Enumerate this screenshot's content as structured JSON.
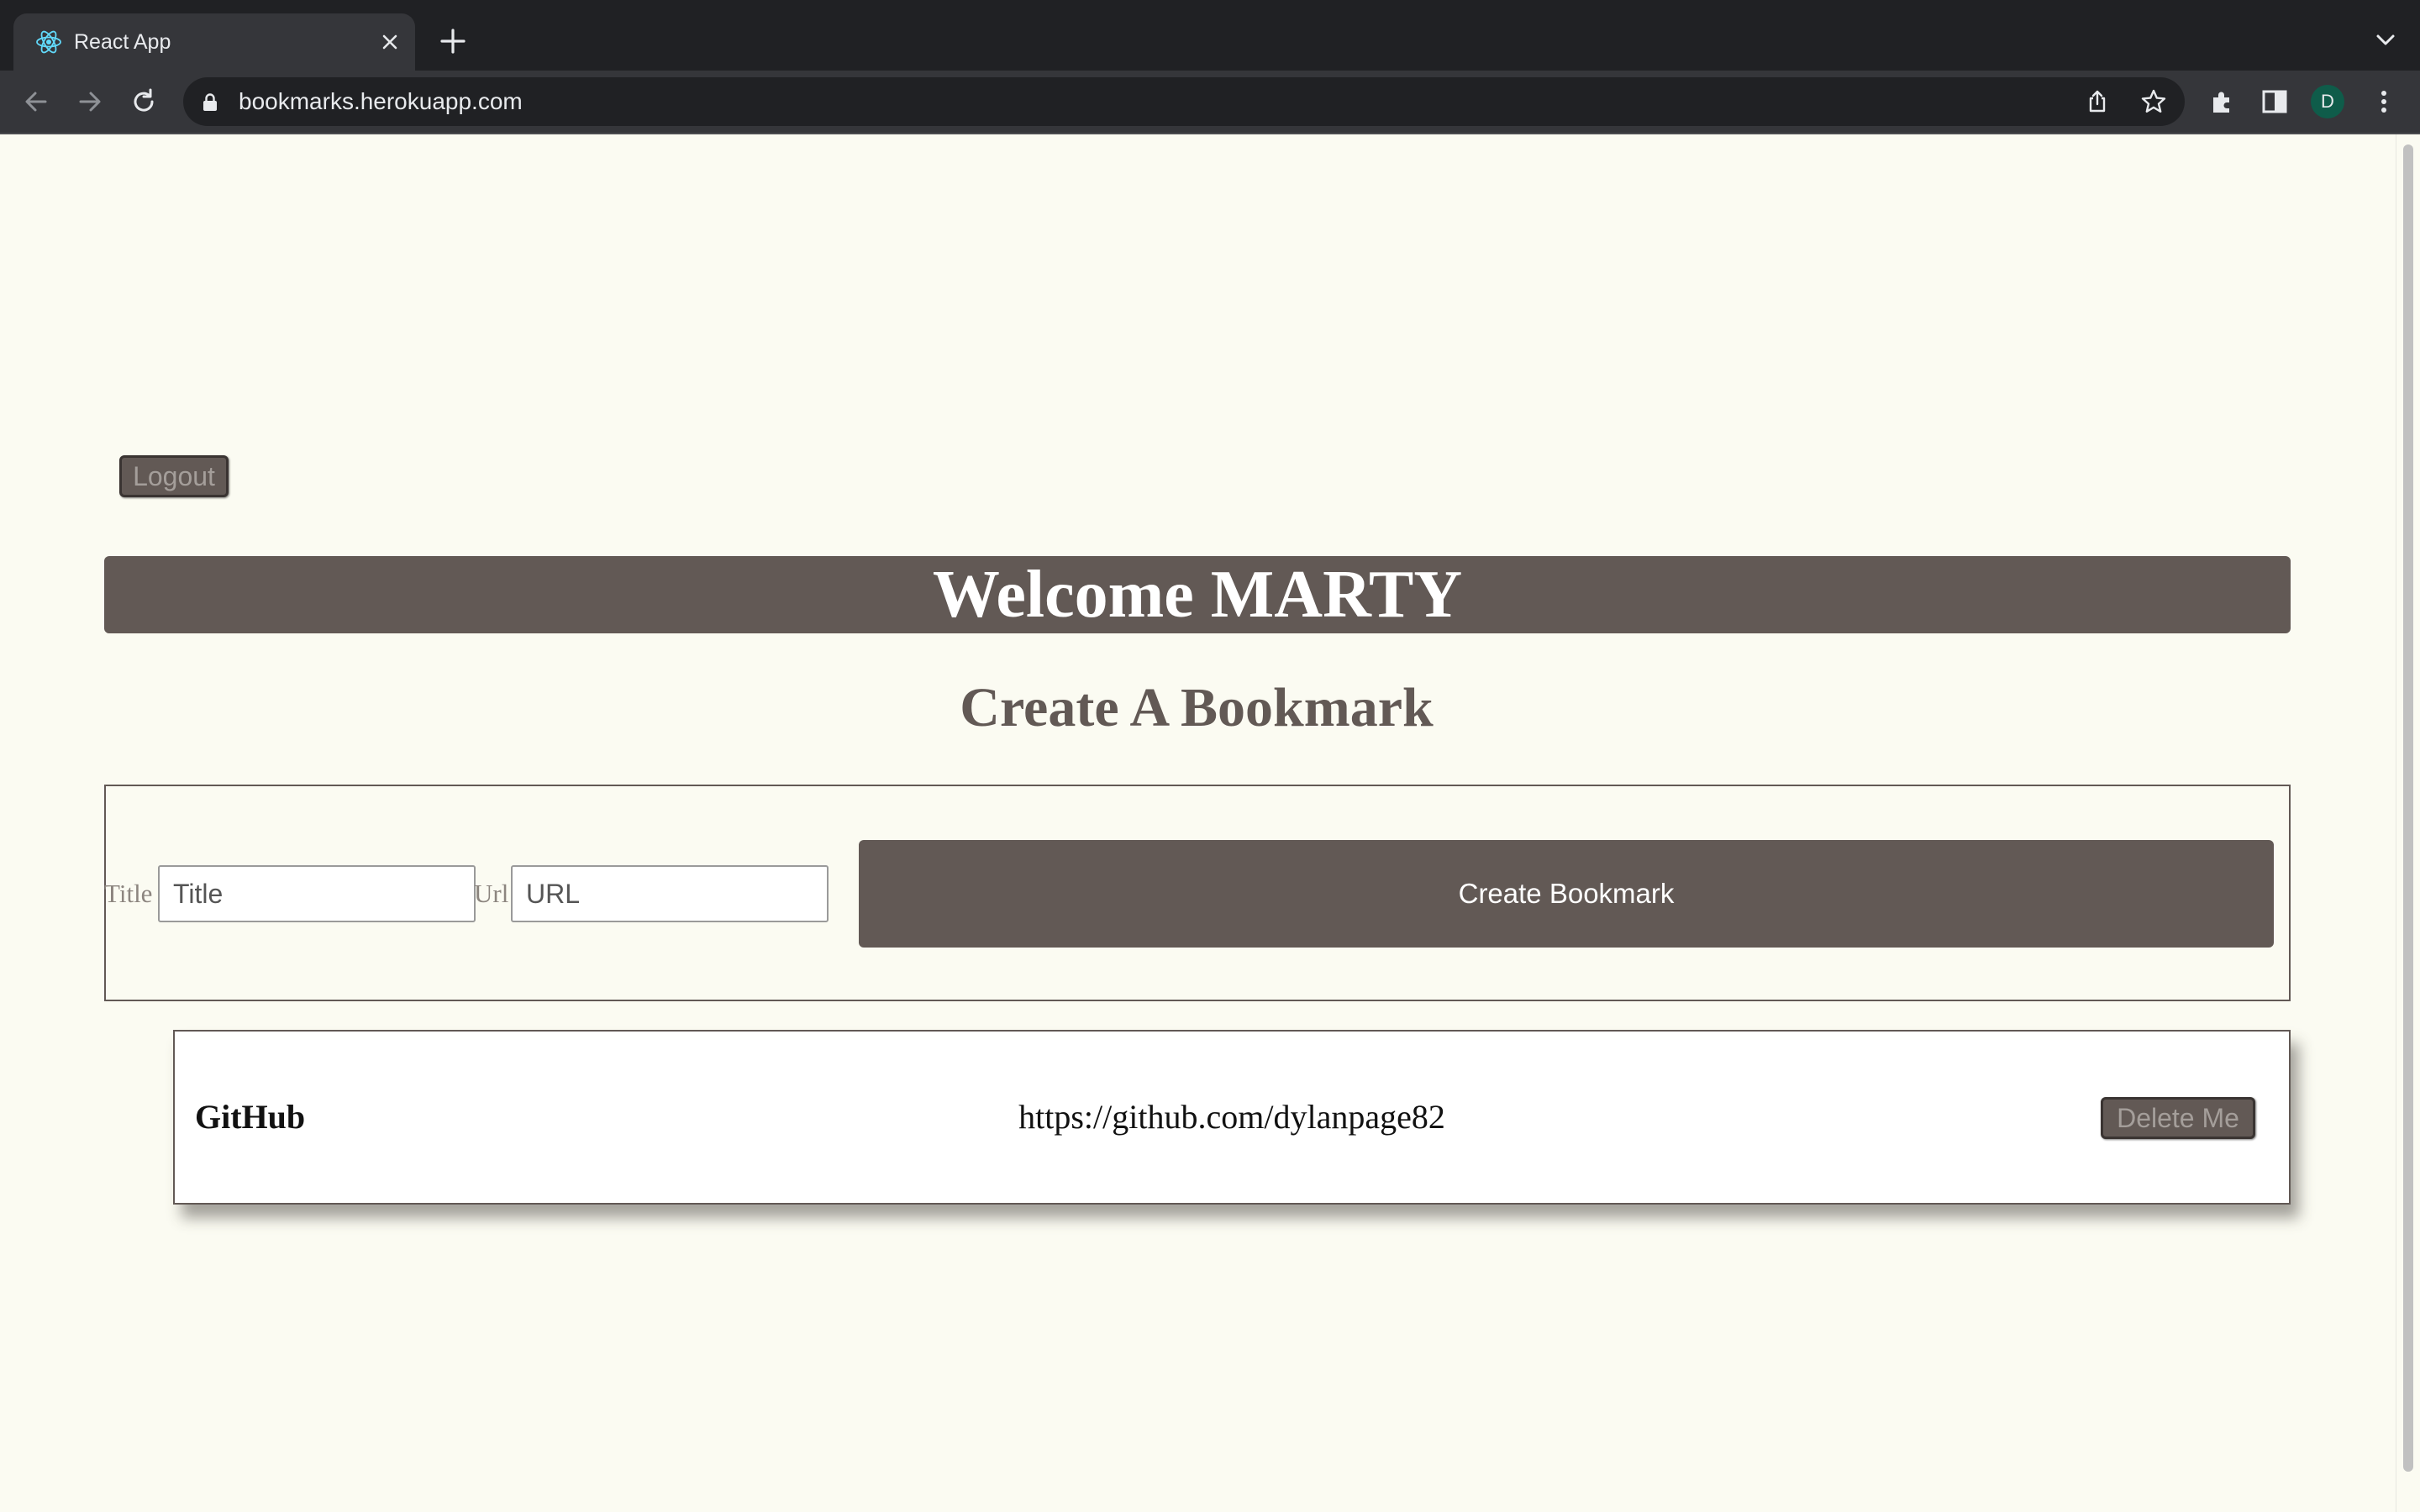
{
  "browser": {
    "tab_title": "React App",
    "address": "bookmarks.herokuapp.com",
    "profile_initial": "D"
  },
  "page": {
    "logout_label": "Logout",
    "welcome": "Welcome MARTY",
    "create_heading": "Create A Bookmark",
    "form": {
      "title_label": "Title",
      "title_placeholder": "Title",
      "title_value": "",
      "url_label": "Url",
      "url_placeholder": "URL",
      "url_value": "",
      "submit_label": "Create Bookmark"
    },
    "bookmarks": [
      {
        "title": "GitHub",
        "url": "https://github.com/dylanpage82",
        "delete_label": "Delete Me"
      }
    ]
  },
  "colors": {
    "page_background": "#fbfbf2",
    "accent": "#625955",
    "chrome_dark": "#202124",
    "chrome_toolbar": "#35363a"
  }
}
